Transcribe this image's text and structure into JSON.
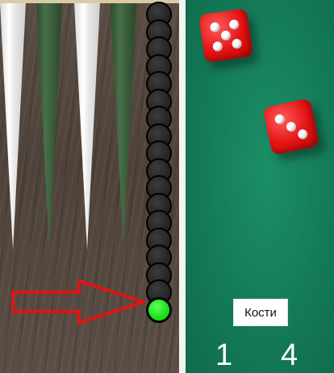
{
  "board": {
    "checker_count": 18,
    "active_checker_color": "#18e018",
    "checker_color": "#222222",
    "arrow_color": "#e01414",
    "point_colors": [
      "#ffffff",
      "#3e643f"
    ]
  },
  "dice": {
    "button_label": "Кости",
    "values": [
      "1",
      "4"
    ],
    "die_color": "#e31212",
    "die_faces": [
      5,
      3
    ]
  },
  "table": {
    "felt_color": "#147a57"
  }
}
